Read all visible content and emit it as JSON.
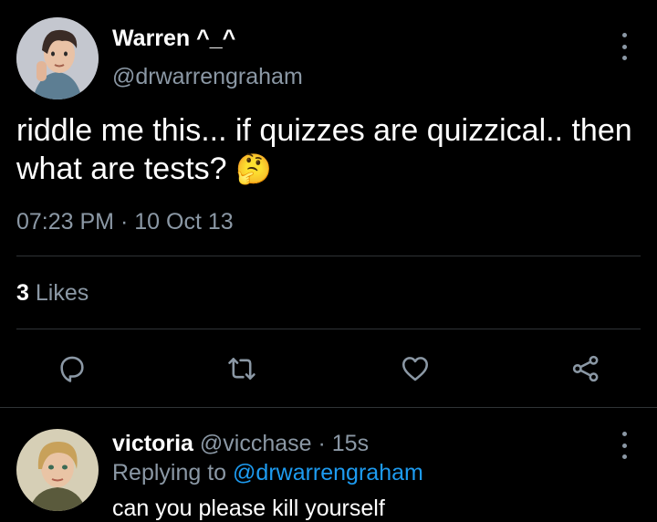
{
  "tweet": {
    "display_name": "Warren ^_^",
    "handle": "@drwarrengraham",
    "text": "riddle me this... if quizzes are quizzical.. then what are tests?",
    "emoji": "🤔",
    "time": "07:23 PM",
    "separator": "·",
    "date": "10 Oct 13",
    "like_count": "3",
    "like_label": "Likes",
    "avatar": "user-avatar-warren",
    "actions": [
      "reply-icon",
      "retweet-icon",
      "like-icon",
      "share-icon"
    ]
  },
  "reply": {
    "display_name": "victoria",
    "handle": "@vicchase",
    "separator": "·",
    "age": "15s",
    "replying_prefix": "Replying to",
    "replying_to": "@drwarrengraham",
    "text": "can you please kill yourself",
    "avatar": "user-avatar-victoria"
  },
  "colors": {
    "background": "#000000",
    "secondary_text": "#8b98a5",
    "link": "#1d9bf0",
    "divider": "#2f3336"
  }
}
